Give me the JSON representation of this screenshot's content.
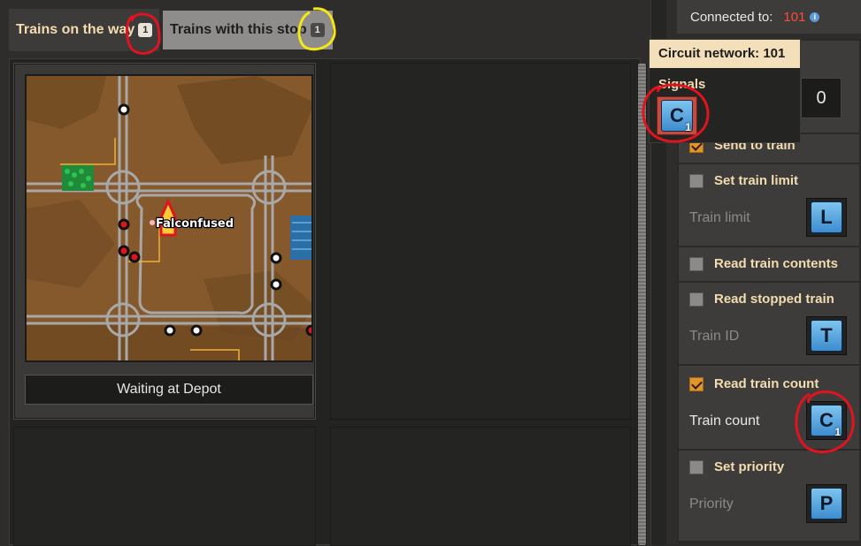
{
  "tabs": [
    {
      "label": "Trains on the way",
      "badge": "1",
      "active": true
    },
    {
      "label": "Trains with this stop",
      "badge": "1",
      "active": false
    }
  ],
  "train": {
    "map_label": "Falconfused",
    "status": "Waiting at Depot"
  },
  "connection": {
    "label": "Connected to:",
    "network_id": "101",
    "info_icon": "info-icon"
  },
  "tooltip": {
    "title": "Circuit network: 101",
    "signals_label": "Signals",
    "signal": {
      "letter": "C",
      "count": "1"
    }
  },
  "settings": {
    "partial_label": "le",
    "constant_value": "0",
    "rows": [
      {
        "label": "Send to train",
        "checked": true
      },
      {
        "label": "Set train limit",
        "checked": false,
        "field": "Train limit",
        "signal": "L"
      },
      {
        "label": "Read train contents",
        "checked": false
      },
      {
        "label": "Read stopped train",
        "checked": false,
        "field": "Train ID",
        "signal": "T"
      },
      {
        "label": "Read train count",
        "checked": true,
        "field": "Train count",
        "signal": "C",
        "signal_count": "1"
      },
      {
        "label": "Set priority",
        "checked": false,
        "field": "Priority",
        "signal": "P"
      }
    ]
  },
  "colors": {
    "accent_checked": "#e39427",
    "header_text": "#f2dcb0",
    "network_id": "#ff4a3a",
    "signal_blue": "#3c8cd0",
    "annotation_red": "#e0141e",
    "annotation_yellow": "#f5e616"
  }
}
